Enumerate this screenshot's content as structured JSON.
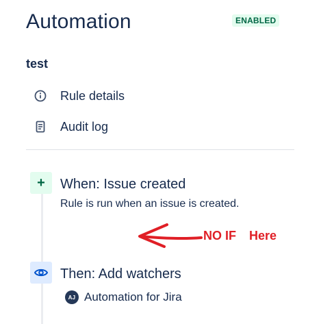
{
  "header": {
    "title": "Automation",
    "status": "ENABLED"
  },
  "rule": {
    "name": "test"
  },
  "nav": {
    "items": [
      {
        "label": "Rule details",
        "icon": "info-icon"
      },
      {
        "label": "Audit log",
        "icon": "document-icon"
      }
    ]
  },
  "steps": {
    "trigger": {
      "icon": "plus-icon",
      "icon_glyph": "+",
      "title": "When: Issue created",
      "description": "Rule is run when an issue is created."
    },
    "action": {
      "icon": "eye-icon",
      "title": "Then: Add watchers",
      "actor": {
        "initials": "AJ",
        "name": "Automation for Jira"
      }
    }
  },
  "annotation": {
    "text_primary": "NO IF",
    "text_secondary": "Here",
    "color": "#e01f26"
  },
  "colors": {
    "text": "#172b4d",
    "badge_bg": "#e3fcef",
    "badge_text": "#006644",
    "action_icon_bg": "#deebff",
    "action_icon": "#0052cc",
    "divider": "#dfe1e6"
  }
}
